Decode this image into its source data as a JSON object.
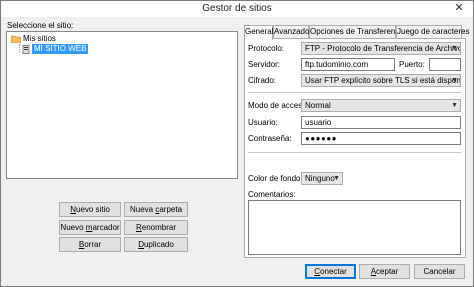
{
  "window": {
    "title": "Gestor de sitios",
    "close_glyph": "✕"
  },
  "tree": {
    "label": "Seleccione el sitio:",
    "root": "Mis sitios",
    "child": "MI SITIO WEB"
  },
  "left_buttons": {
    "new_site": "Nuevo sitio",
    "new_folder": "Nueva carpeta",
    "new_bookmark": "Nuevo marcador",
    "rename": "Renombrar",
    "delete": "Borrar",
    "duplicate": "Duplicado"
  },
  "tabs": [
    "General",
    "Avanzado",
    "Opciones de Transferencia",
    "Juego de caracteres"
  ],
  "general": {
    "protocol_label": "Protocolo:",
    "protocol_value": "FTP - Protocolo de Transferencia de Archivos",
    "server_label": "Servidor:",
    "server_value": "ftp.tudominio.com",
    "port_label": "Puerto:",
    "port_value": "",
    "encryption_label": "Cifrado:",
    "encryption_value": "Usar FTP explícito sobre TLS si está disponible",
    "access_label": "Modo de acceso:",
    "access_value": "Normal",
    "user_label": "Usuario:",
    "user_value": "usuario",
    "password_label": "Contraseña:",
    "password_value": "●●●●●●",
    "bgcolor_label": "Color de fondo:",
    "bgcolor_value": "Ninguno",
    "comments_label": "Comentarios:"
  },
  "bottom_buttons": {
    "connect": "Conectar",
    "accept": "Aceptar",
    "cancel": "Cancelar"
  }
}
